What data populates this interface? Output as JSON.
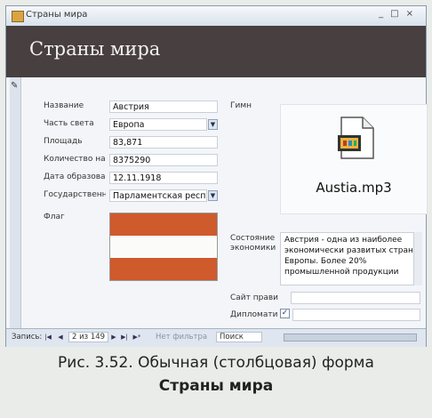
{
  "window": {
    "title": "Страны мира"
  },
  "form": {
    "header": "Страны мира",
    "fields": {
      "name": {
        "label": "Название",
        "value": "Австрия"
      },
      "part": {
        "label": "Часть света",
        "value": "Европа"
      },
      "area": {
        "label": "Площадь",
        "value": "83,871"
      },
      "population": {
        "label": "Количество нас",
        "value": "8375290"
      },
      "founded": {
        "label": "Дата образован",
        "value": "12.11.1918"
      },
      "government": {
        "label": "Государственна",
        "value": "Парламентская респуб"
      },
      "flag": {
        "label": "Флаг"
      },
      "hymn": {
        "label": "Гимн",
        "file": "Austia.mp3"
      },
      "economy": {
        "label": "Состояние экономики",
        "value": "Австрия - одна из наиболее экономически развитых стран Европы. Более 20% промышленной продукции"
      },
      "gov_site": {
        "label": "Сайт правит",
        "value": ""
      },
      "diplomatic": {
        "label": "Дипломатич",
        "checked": true
      }
    }
  },
  "navigation": {
    "record_label": "Запись:",
    "record_position": "2 из 149",
    "filter_label": "Нет фильтра",
    "search_label": "Поиск"
  },
  "caption": {
    "line1": "Рис. 3.52. Обычная (столбцовая) форма",
    "line2": "Страны мира"
  },
  "colors": {
    "header_bg": "#473f40",
    "flag_red": "#cf5a2c",
    "flag_white": "#fbfbfa"
  }
}
